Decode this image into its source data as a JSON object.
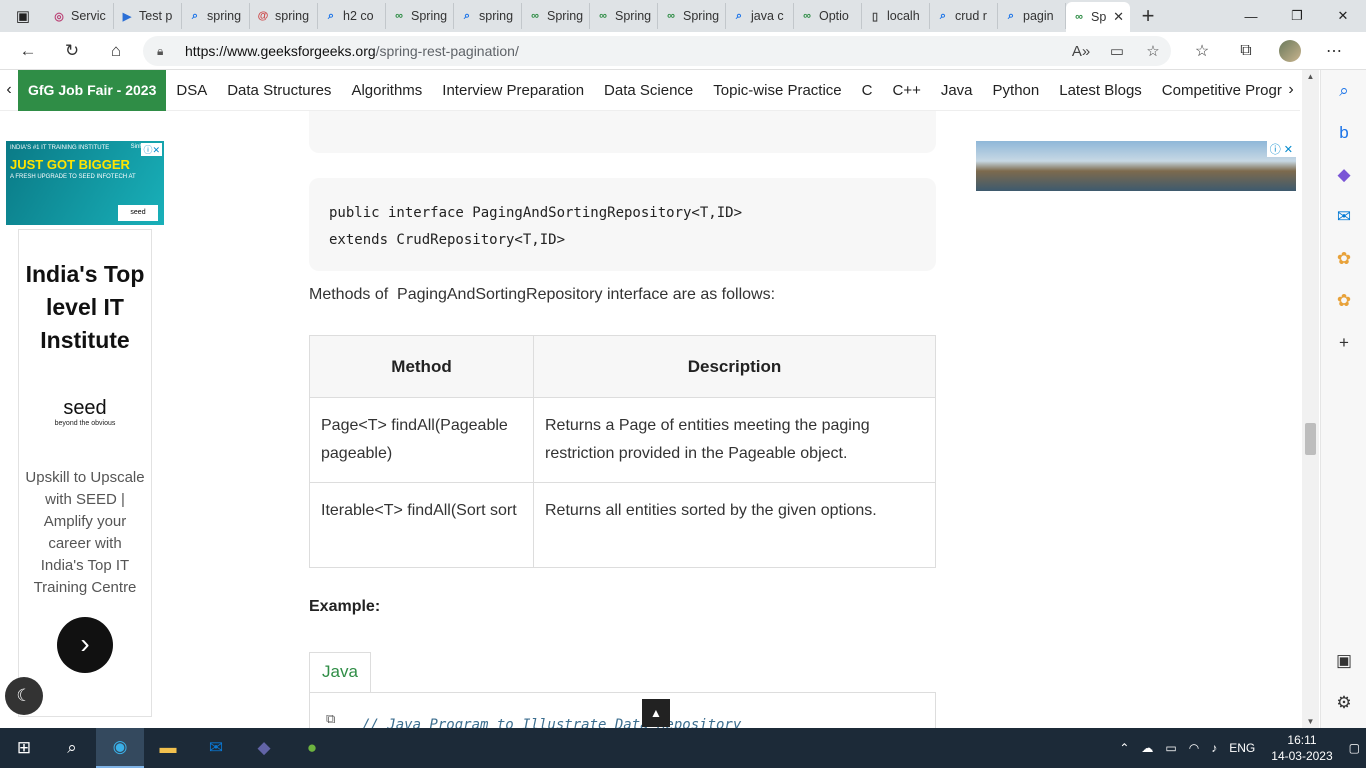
{
  "browser": {
    "tabs": [
      {
        "label": "Servic",
        "icon": "generic-site-icon"
      },
      {
        "label": "Test p",
        "icon": "video-icon"
      },
      {
        "label": "spring",
        "icon": "search-icon"
      },
      {
        "label": "spring",
        "icon": "swirl-icon"
      },
      {
        "label": "h2 co",
        "icon": "search-icon"
      },
      {
        "label": "Spring",
        "icon": "gfg-icon"
      },
      {
        "label": "spring",
        "icon": "search-icon"
      },
      {
        "label": "Spring",
        "icon": "gfg-icon"
      },
      {
        "label": "Spring",
        "icon": "gfg-icon"
      },
      {
        "label": "Spring",
        "icon": "gfg-icon"
      },
      {
        "label": "java c",
        "icon": "search-icon"
      },
      {
        "label": "Optio",
        "icon": "gfg-icon"
      },
      {
        "label": "localh",
        "icon": "page-icon"
      },
      {
        "label": "crud r",
        "icon": "search-icon"
      },
      {
        "label": "pagin",
        "icon": "search-icon"
      }
    ],
    "active_tab": {
      "label": "Sp",
      "icon": "gfg-icon"
    },
    "url_host": "https://www.geeksforgeeks.org",
    "url_path": "/spring-rest-pagination/"
  },
  "sitenav": {
    "jobfair": "GfG Job Fair - 2023",
    "links": [
      "DSA",
      "Data Structures",
      "Algorithms",
      "Interview Preparation",
      "Data Science",
      "Topic-wise Practice",
      "C",
      "C++",
      "Java",
      "Python",
      "Latest Blogs",
      "Competitive Progra"
    ]
  },
  "leftad": {
    "banner_small_top": "INDIA'S #1 IT TRAINING INSTITUTE",
    "banner_big": "JUST GOT BIGGER",
    "banner_small": "A FRESH UPGRADE TO SEED INFOTECH AT",
    "banner_place": "Sinhagad",
    "banner_card": "seed",
    "title": "India's Top level IT Institute",
    "logo": "seed",
    "logo_tag": "beyond the obvious",
    "desc": "Upskill to Upscale with SEED | Amplify your career with India's Top IT Training Centre"
  },
  "content": {
    "code1": "public interface PagingAndSortingRepository<T,ID>",
    "code2": "extends CrudRepository<T,ID>",
    "para": "Methods of  PagingAndSortingRepository interface are as follows:",
    "table": {
      "headers": [
        "Method",
        "Description"
      ],
      "rows": [
        [
          "Page<T> findAll(Pageable pageable)",
          "Returns a Page of entities meeting the paging restriction provided in the Pageable object."
        ],
        [
          "Iterable<T> findAll(Sort sort",
          "Returns all entities sorted by the given options."
        ]
      ]
    },
    "example": "Example:",
    "lang_tab": "Java",
    "code_comment": "// Java Program to Illustrate Data Repository"
  },
  "taskbar": {
    "lang": "ENG",
    "time": "16:11",
    "date": "14-03-2023"
  }
}
